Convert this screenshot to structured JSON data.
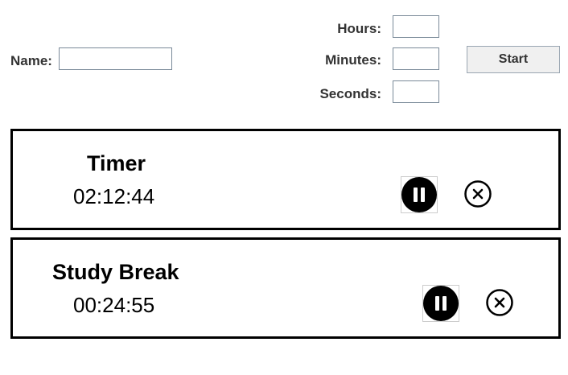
{
  "form": {
    "name_label": "Name:",
    "name_value": "",
    "hours_label": "Hours:",
    "hours_value": "",
    "minutes_label": "Minutes:",
    "minutes_value": "",
    "seconds_label": "Seconds:",
    "seconds_value": "",
    "start_label": "Start"
  },
  "timers": [
    {
      "title": "Timer",
      "time": "02:12:44",
      "pause_icon": "pause-icon",
      "cancel_icon": "close-circle-icon"
    },
    {
      "title": "Study Break",
      "time": "00:24:55",
      "pause_icon": "pause-icon",
      "cancel_icon": "close-circle-icon"
    }
  ],
  "colors": {
    "label_text": "#333333",
    "card_border": "#000000",
    "button_bg": "#f0f0f0"
  }
}
